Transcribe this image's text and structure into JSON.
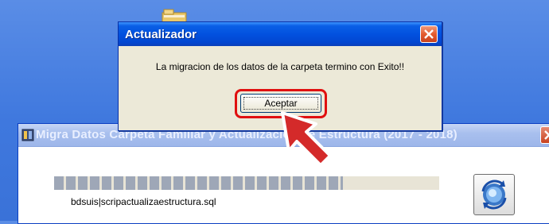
{
  "dialog": {
    "title": "Actualizador",
    "message": "La migracion de los datos de la carpeta termino con Exito!!",
    "accept_label": "Aceptar"
  },
  "back_window": {
    "title": "Migra Datos Carpeta Familiar y Actualización de Estructura (2017 - 2018)",
    "status_text": "bdsuis|scripactualizaestructura.sql",
    "progress_fraction": 0.75
  },
  "icons": {
    "dialog_close": "close-icon",
    "back_close": "close-icon",
    "app": "app-icon",
    "refresh": "refresh-icon",
    "folder": "folder-icon",
    "pointer": "red-arrow-icon"
  },
  "colors": {
    "highlight": "#e01010",
    "titlebar": "#0251df"
  }
}
